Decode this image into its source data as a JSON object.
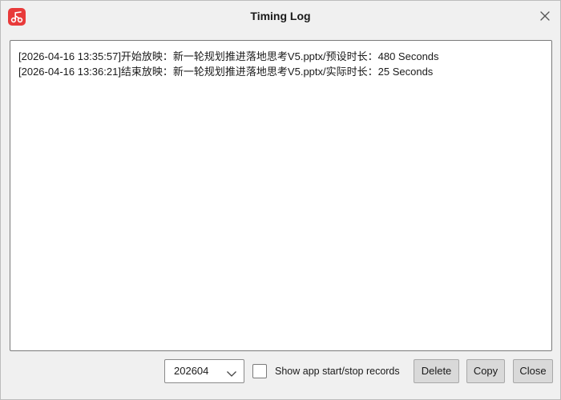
{
  "window": {
    "title": "Timing Log",
    "accent_color": "#e83a3a",
    "app_icon": "music-note-icon",
    "close_icon": "close-icon"
  },
  "log": {
    "lines": [
      "[2026-04-16 13:35:57]开始放映：新一轮规划推进落地思考V5.pptx/预设时长：480 Seconds",
      "[2026-04-16 13:36:21]结束放映：新一轮规划推进落地思考V5.pptx/实际时长：25 Seconds"
    ]
  },
  "controls": {
    "month_value": "202604",
    "show_app_records_label": "Show app start/stop records",
    "show_app_records_checked": false,
    "delete_label": "Delete",
    "copy_label": "Copy",
    "close_label": "Close"
  }
}
